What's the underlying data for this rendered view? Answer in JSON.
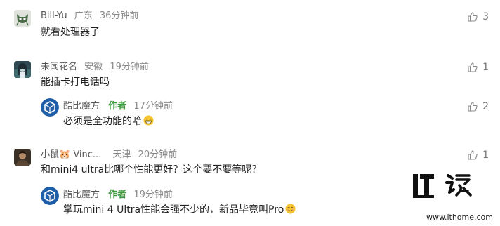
{
  "comments": [
    {
      "user": "Bill-Yu",
      "location": "广东",
      "time": "36分钟前",
      "text": "就看处理器了",
      "likes": "3",
      "avatar_icon": "cat-face-icon"
    },
    {
      "user": "未闻花名",
      "location": "安徽",
      "time": "19分钟前",
      "text": "能插卡打电话吗",
      "likes": "1",
      "avatar_icon": "anime-girl-icon",
      "reply": {
        "user": "酷比魔方",
        "author_badge": "作者",
        "time": "17分钟前",
        "text": "必须是全功能的哈",
        "likes": "2",
        "emoji": "grinning-face-icon"
      }
    },
    {
      "user": "小鼠🐹 Vinc...",
      "location": "天津",
      "time": "20分钟前",
      "text": "和mini4 ultra比哪个性能更好？这个要不要等呢？",
      "likes": "1",
      "avatar_icon": "man-portrait-icon",
      "reply": {
        "user": "酷比魔方",
        "author_badge": "作者",
        "time": "19分钟前",
        "text": "掌玩mini 4 Ultra性能会强不少的，新品毕竟叫Pro",
        "emoji": "smiling-face-icon"
      }
    }
  ],
  "watermark": {
    "url": "www.ithome.com",
    "logo": "ithome-logo"
  },
  "colors": {
    "author": "#3d9a3f",
    "meta": "#888888",
    "text": "#222222"
  }
}
